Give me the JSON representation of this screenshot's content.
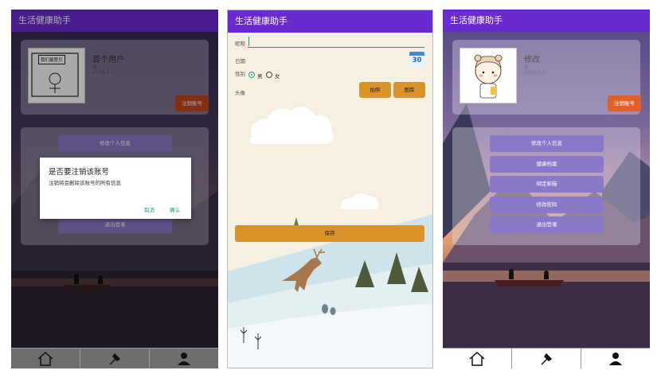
{
  "app_title": "生活健康助手",
  "screen1": {
    "nickname": "首个用户",
    "gender": "男",
    "birth": "2000-1-1",
    "avatar_caption": "我们最登贝",
    "cancel_account_button": "注销账号",
    "menu": [
      "修改个人信息",
      "退出登录"
    ],
    "dialog": {
      "title": "是否要注销该账号",
      "message": "注销将会删除该账号的所有信息",
      "cancel": "取消",
      "confirm": "确认"
    }
  },
  "screen2": {
    "nickname_label": "昵称",
    "date_label": "日期",
    "calendar_day": "30",
    "gender_label": "性别",
    "gender_male": "男",
    "gender_female": "女",
    "avatar_label": "头像",
    "camera_button": "拍照",
    "gallery_button": "图库",
    "save_button": "保存"
  },
  "screen3": {
    "nickname": "修改",
    "gender": "男",
    "birth": "2000-1-1",
    "cancel_account_button": "注销账号",
    "menu": [
      "修改个人信息",
      "健康档案",
      "绑定邮箱",
      "修改密码",
      "退出登录"
    ]
  },
  "nav": [
    "home-icon",
    "hammer-icon",
    "user-icon"
  ],
  "colors": {
    "appbar": "#6b2ad0",
    "accent_orange": "#e0602a",
    "save_gold": "#d9932a",
    "menu_purple": "#8a78c8"
  }
}
